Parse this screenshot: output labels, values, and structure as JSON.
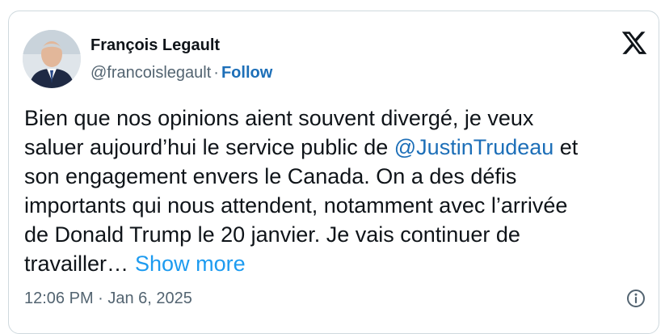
{
  "author": {
    "name": "François Legault",
    "handle": "@francoislegault",
    "separator": "·",
    "follow_label": "Follow"
  },
  "logo_icon": "x-logo-icon",
  "tweet": {
    "text_line_1": "Bien que nos opinions aient souvent divergé, je veux",
    "text_line_2_before": "saluer aujourd’hui le service public de ",
    "mention": "@JustinTrudeau",
    "text_line_2_after": " et",
    "text_line_3": "son engagement envers le Canada. On a des défis",
    "text_line_4": "importants qui nous attendent, notamment avec l’arrivée",
    "text_line_5": "de Donald Trump le 20 janvier. Je vais continuer de",
    "text_line_6": "travailler…",
    "show_more_label": "Show more"
  },
  "timestamp": "12:06 PM · Jan 6, 2025",
  "info_icon": "info-circle-icon",
  "colors": {
    "text": "#0f1419",
    "secondary": "#536471",
    "link": "#1d6fb8",
    "show_more": "#1d9bf0",
    "border": "#cfd9de"
  }
}
